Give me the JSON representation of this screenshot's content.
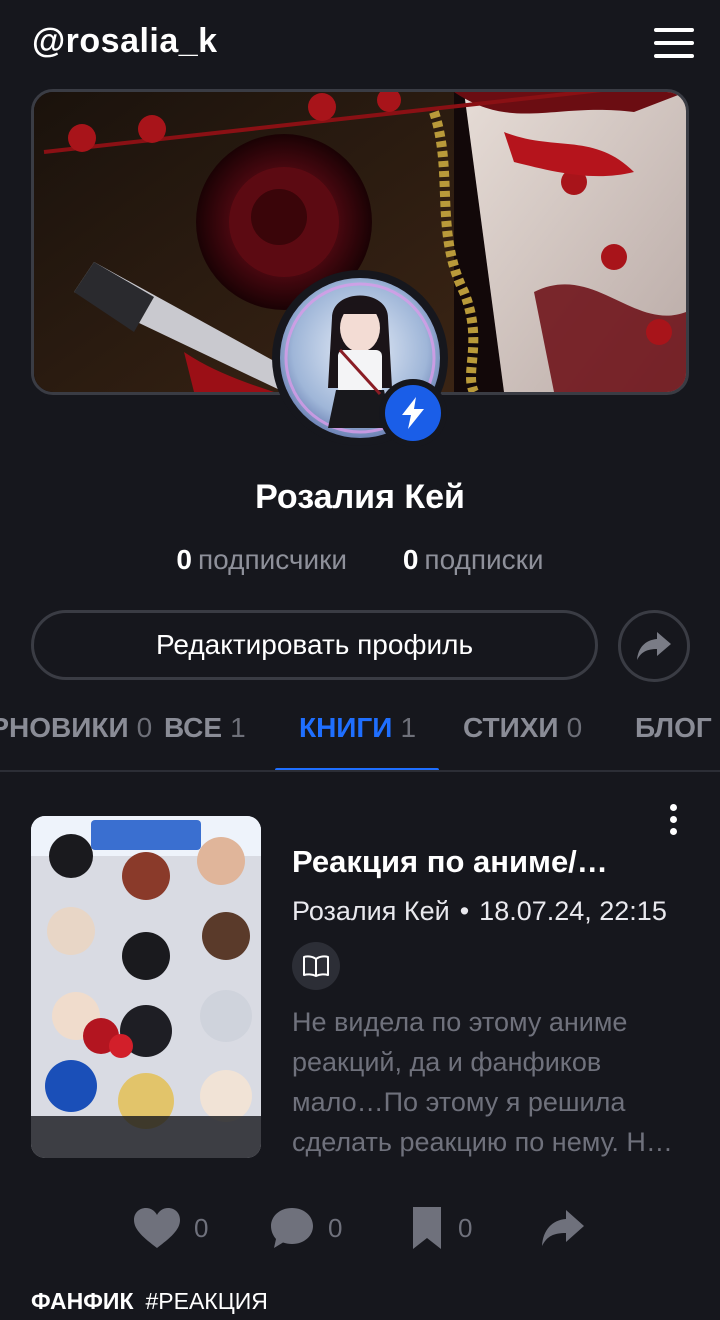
{
  "header": {
    "username": "@rosalia_k"
  },
  "profile": {
    "name": "Розалия Кей",
    "followers_count": "0",
    "followers_label": "подписчики",
    "following_count": "0",
    "following_label": "подписки",
    "edit_label": "Редактировать профиль"
  },
  "tabs": [
    {
      "label": "ЧЕРНОВИКИ",
      "count": "0"
    },
    {
      "label": "ВСЕ",
      "count": "1"
    },
    {
      "label": "КНИГИ",
      "count": "1",
      "active": true
    },
    {
      "label": "СТИХИ",
      "count": "0"
    },
    {
      "label": "БЛОГ",
      "count": ""
    }
  ],
  "post": {
    "title": "Реакция по аниме/…",
    "author": "Розалия Кей",
    "separator": "•",
    "date": "18.07.24, 22:15",
    "description": "Не видела по этому аниме реакций, да и фанфиков мало…По этому я решила сделать реакцию по нему. Н…",
    "likes": "0",
    "comments": "0",
    "bookmarks": "0",
    "type_tag": "ФАНФИК",
    "hashtag": "#РЕАКЦИЯ"
  },
  "colors": {
    "background": "#16171d",
    "accent": "#1f6fff",
    "muted": "#6f717c",
    "border": "#3a3c44"
  },
  "icons": {
    "menu": "hamburger-icon",
    "badge": "lightning-icon",
    "share": "share-arrow-icon",
    "more": "more-vertical-icon",
    "book": "book-icon",
    "like": "heart-icon",
    "comment": "comment-icon",
    "bookmark": "bookmark-icon"
  }
}
